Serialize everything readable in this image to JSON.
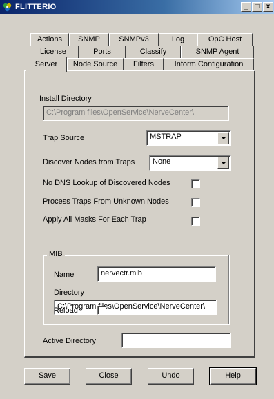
{
  "window": {
    "title": "FLITTERIO",
    "buttons": {
      "minimize": "_",
      "maximize": "□",
      "close": "x"
    }
  },
  "tabs": {
    "row1": [
      "Actions",
      "SNMP",
      "SNMPv3",
      "Log",
      "OpC Host"
    ],
    "row2": [
      "License",
      "Ports",
      "Classify",
      "SNMP Agent"
    ],
    "row3": [
      "Server",
      "Node Source",
      "Filters",
      "Inform Configuration"
    ],
    "active": "Server"
  },
  "server": {
    "install_directory_label": "Install Directory",
    "install_directory_value": "C:\\Program files\\OpenService\\NerveCenter\\",
    "trap_source_label": "Trap Source",
    "trap_source_value": "MSTRAP",
    "discover_nodes_label": "Discover Nodes from Traps",
    "discover_nodes_value": "None",
    "no_dns_label": "No DNS Lookup of Discovered Nodes",
    "no_dns_checked": false,
    "process_traps_label": "Process Traps From Unknown Nodes",
    "process_traps_checked": false,
    "apply_masks_label": "Apply All Masks For Each Trap",
    "apply_masks_checked": false,
    "mib": {
      "group_label": "MIB",
      "name_label": "Name",
      "name_value": "nervectr.mib",
      "directory_label": "Directory",
      "directory_value": "C:\\Program files\\OpenService\\NerveCenter\\",
      "reload_label": "Reload",
      "reload_checked": false
    },
    "active_directory_label": "Active Directory",
    "active_directory_value": ""
  },
  "footer": {
    "save_label": "Save",
    "close_label": "Close",
    "undo_label": "Undo",
    "help_label": "Help"
  },
  "colors": {
    "face": "#d4d0c8",
    "title_start": "#0a246a",
    "title_end": "#a6caf0"
  }
}
